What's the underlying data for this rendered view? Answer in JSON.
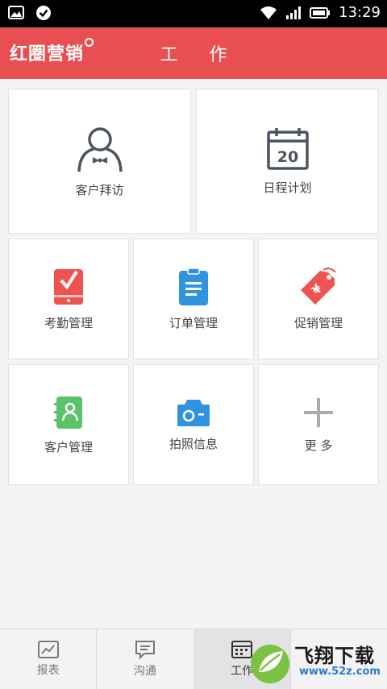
{
  "status_bar": {
    "time": "13:29",
    "icons": [
      "image-icon",
      "check-circle-icon",
      "wifi-icon",
      "signal-icon",
      "battery-icon"
    ]
  },
  "app_bar": {
    "brand": "红圈营销",
    "title": "工 作",
    "color": "#e84e52"
  },
  "tiles": {
    "customer_visit": "客户拜访",
    "schedule": "日程计划",
    "schedule_date": "20",
    "attendance": "考勤管理",
    "orders": "订单管理",
    "promotions": "促销管理",
    "customers": "客户管理",
    "photo_info": "拍照信息",
    "more": "更 多"
  },
  "tab_bar": {
    "tabs": [
      {
        "label": "报表",
        "icon": "chart-icon"
      },
      {
        "label": "沟通",
        "icon": "message-icon"
      },
      {
        "label": "工作",
        "icon": "calendar-grid-icon",
        "active": true
      },
      {
        "label": "",
        "icon": "hidden-icon"
      }
    ]
  },
  "watermark": {
    "text": "飞翔下载",
    "sub": "www.52z.com"
  },
  "colors": {
    "accent": "#e84e52",
    "attendance": "#ef5350",
    "orders": "#2f94dd",
    "promotions": "#ef5350",
    "customers": "#5cc26a",
    "photo": "#2f94dd"
  }
}
